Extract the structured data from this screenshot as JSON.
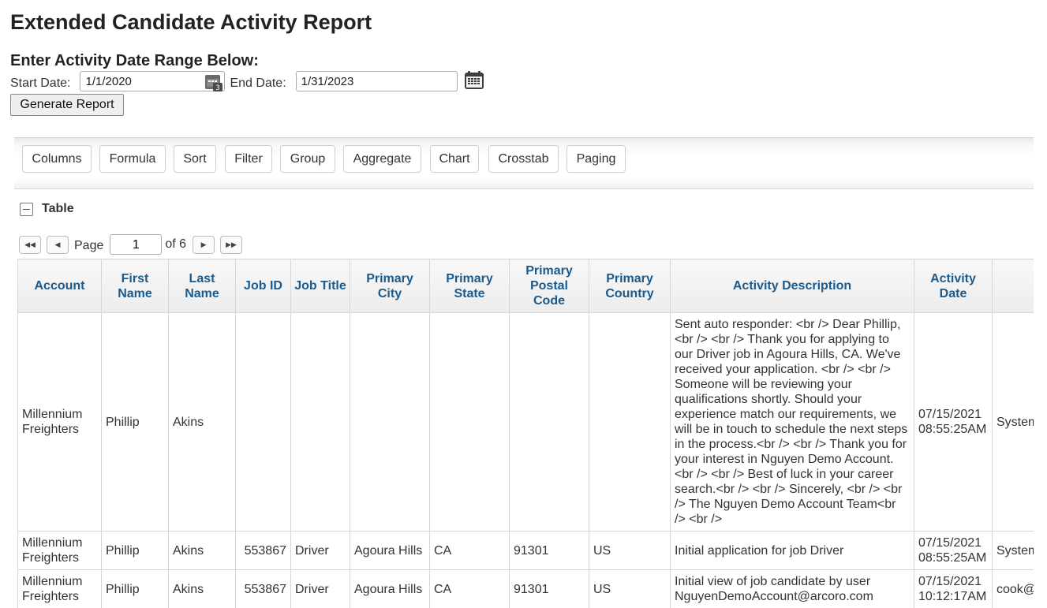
{
  "title": "Extended Candidate Activity Report",
  "date_range": {
    "heading": "Enter Activity Date Range Below:",
    "start_label": "Start Date:",
    "start_value": "1/1/2020",
    "end_label": "End Date:",
    "end_value": "1/31/2023",
    "generate_label": "Generate Report"
  },
  "toolbar": [
    "Columns",
    "Formula",
    "Sort",
    "Filter",
    "Group",
    "Aggregate",
    "Chart",
    "Crosstab",
    "Paging"
  ],
  "section_label": "Table",
  "pager": {
    "page_label": "Page",
    "current_page": "1",
    "of_label": "of 6"
  },
  "columns": [
    "Account",
    "First Name",
    "Last Name",
    "Job ID",
    "Job Title",
    "Primary City",
    "Primary State",
    "Primary Postal Code",
    "Primary Country",
    "Activity Description",
    "Activity Date",
    ""
  ],
  "rows": [
    [
      "Millennium Freighters",
      "Phillip",
      "Akins",
      "",
      "",
      "",
      "",
      "",
      "",
      "Sent auto responder: <br /> Dear Phillip, <br /> <br /> Thank you for applying to our Driver job in Agoura Hills, CA. We've received your application. <br /> <br /> Someone will be reviewing your qualifications shortly. Should your experience match our requirements, we will be in touch to schedule the next steps in the process.<br /> <br /> Thank you for your interest in Nguyen Demo Account.<br /> <br /> Best of luck in your career search.<br /> <br /> Sincerely, <br /> <br /> The Nguyen Demo Account Team<br /> <br />",
      "07/15/2021 08:55:25AM",
      "System"
    ],
    [
      "Millennium Freighters",
      "Phillip",
      "Akins",
      "553867",
      "Driver",
      "Agoura Hills",
      "CA",
      "91301",
      "US",
      "Initial application for job Driver",
      "07/15/2021 08:55:25AM",
      "System"
    ],
    [
      "Millennium Freighters",
      "Phillip",
      "Akins",
      "553867",
      "Driver",
      "Agoura Hills",
      "CA",
      "91301",
      "US",
      "Initial view of job candidate by user NguyenDemoAccount@arcoro.com",
      "07/15/2021 10:12:17AM",
      "cook@"
    ]
  ]
}
